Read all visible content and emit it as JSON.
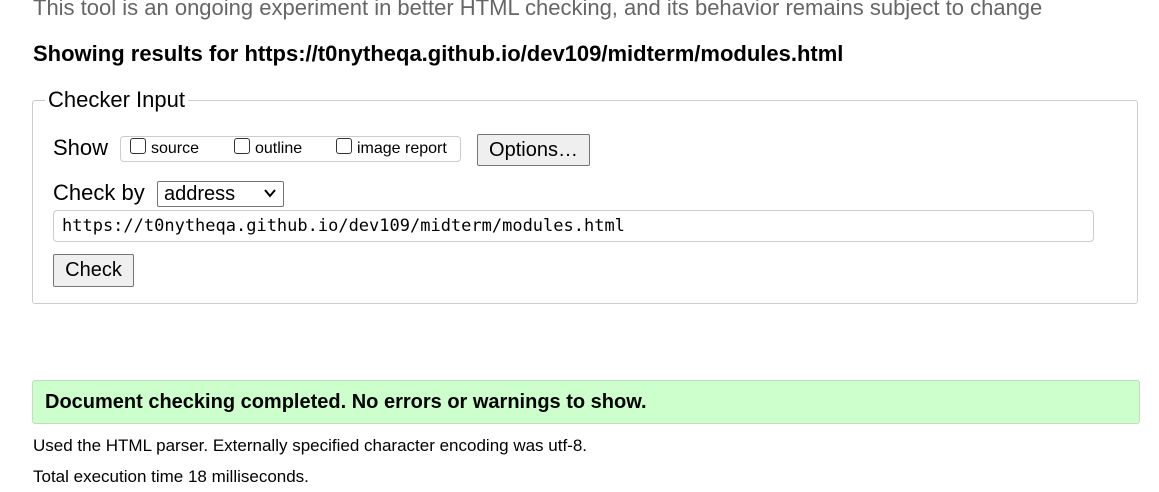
{
  "experiment_note": "This tool is an ongoing experiment in better HTML checking, and its behavior remains subject to change",
  "results_heading": "Showing results for https://t0nytheqa.github.io/dev109/midterm/modules.html",
  "checker": {
    "legend": "Checker Input",
    "show_label": "Show",
    "show_options": [
      {
        "label": "source",
        "checked": false
      },
      {
        "label": "outline",
        "checked": false
      },
      {
        "label": "image report",
        "checked": false
      }
    ],
    "options_button": "Options…",
    "check_by_label": "Check by",
    "check_by_selected": "address",
    "url_value": "https://t0nytheqa.github.io/dev109/midterm/modules.html",
    "check_button": "Check"
  },
  "result": {
    "status_message": "Document checking completed. No errors or warnings to show.",
    "parser_info": "Used the HTML parser. Externally specified character encoding was utf-8.",
    "execution_time": "Total execution time 18 milliseconds."
  },
  "colors": {
    "success_bg": "#ccffcc",
    "muted_text": "#666666"
  }
}
